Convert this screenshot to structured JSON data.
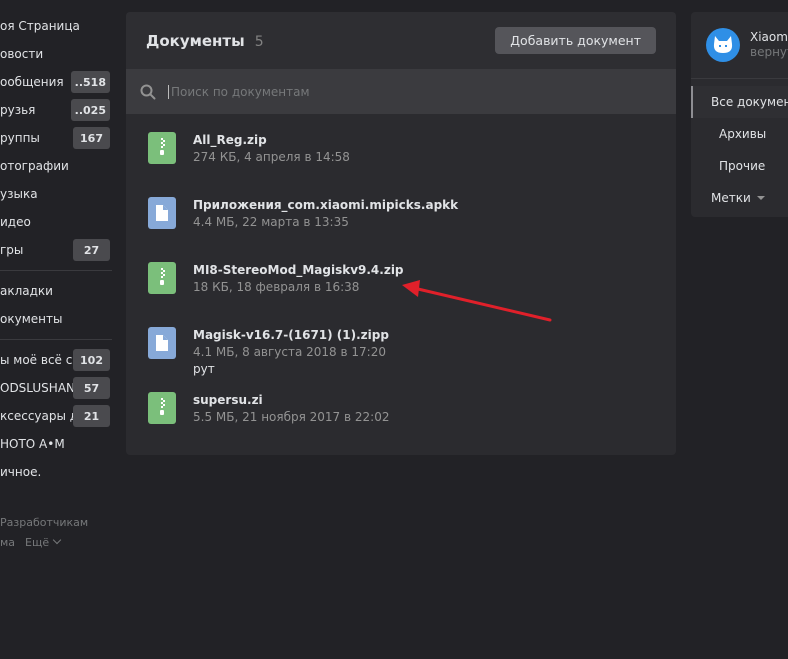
{
  "left_nav": {
    "items": [
      {
        "label": "оя Страница",
        "badge": ""
      },
      {
        "label": "овости",
        "badge": ""
      },
      {
        "label": "ообщения",
        "badge": "..518"
      },
      {
        "label": "рузья",
        "badge": "..025"
      },
      {
        "label": "руппы",
        "badge": "167"
      },
      {
        "label": "отографии",
        "badge": ""
      },
      {
        "label": "узыка",
        "badge": ""
      },
      {
        "label": "идео",
        "badge": ""
      },
      {
        "label": "гры",
        "badge": "27"
      }
    ],
    "items2": [
      {
        "label": "акладки",
        "badge": ""
      },
      {
        "label": "окументы",
        "badge": ""
      }
    ],
    "items3": [
      {
        "label": "ы моё всё со",
        "badge": "102"
      },
      {
        "label": "ODSLUSHAN...",
        "badge": "57"
      },
      {
        "label": "ксессуары д...",
        "badge": "21"
      },
      {
        "label": "НОТО А•М",
        "badge": ""
      },
      {
        "label": "ичное.",
        "badge": ""
      }
    ],
    "footer": {
      "developers": "Разработчикам",
      "left": "ма",
      "more": "Ещё"
    }
  },
  "main": {
    "title": "Документы",
    "count": "5",
    "add_button": "Добавить документ",
    "search_placeholder": "Поиск по документам",
    "docs": [
      {
        "type": "zip",
        "name": "All_Reg.zip",
        "meta": "274 КБ, 4 апреля в 14:58",
        "extra": ""
      },
      {
        "type": "file",
        "name": "Приложения_com.xiaomi.mipicks.apkk",
        "meta": "4.4 МБ, 22 марта в 13:35",
        "extra": ""
      },
      {
        "type": "zip",
        "name": "MI8-StereoMod_Magiskv9.4.zip",
        "meta": "18 КБ, 18 февраля в 16:38",
        "extra": ""
      },
      {
        "type": "file",
        "name": "Magisk-v16.7-(1671) (1).zipp",
        "meta": "4.1 МБ, 8 августа 2018 в 17:20",
        "extra": "рут"
      },
      {
        "type": "zip",
        "name": "supersu.zi",
        "meta": "5.5 МБ, 21 ноября 2017 в 22:02",
        "extra": ""
      }
    ]
  },
  "right_panel": {
    "profile_name": "Xiaomi",
    "profile_sub": "вернут",
    "filters": [
      "Все докумен",
      "Архивы",
      "Прочие"
    ],
    "tags": "Метки"
  },
  "colors": {
    "accent_arrow": "#e0202a",
    "zip_icon": "#7bbf7b",
    "file_icon": "#87a9d8"
  }
}
